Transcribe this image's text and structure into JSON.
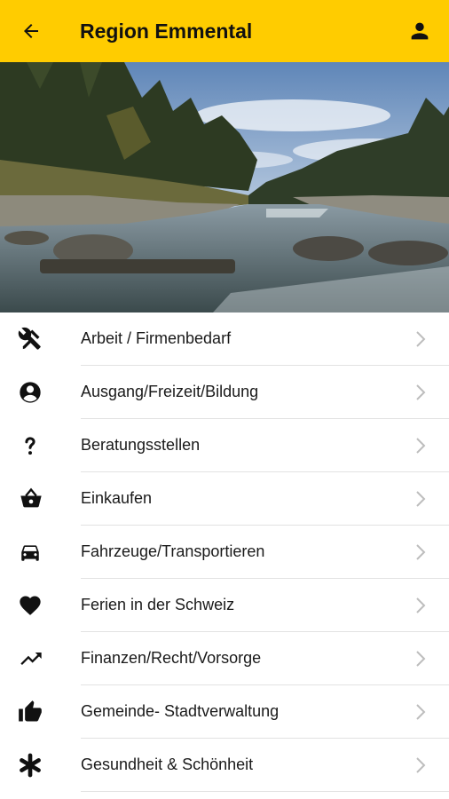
{
  "app": {
    "title": "Region Emmental",
    "accent_color": "#ffcc00"
  },
  "header": {
    "back_icon": "arrow-left-icon",
    "profile_icon": "person-icon"
  },
  "hero": {
    "image": "river-landscape-photo"
  },
  "categories": [
    {
      "label": "Arbeit / Firmenbedarf",
      "icon": "tools-icon"
    },
    {
      "label": "Ausgang/Freizeit/Bildung",
      "icon": "account-circle-icon"
    },
    {
      "label": "Beratungsstellen",
      "icon": "question-mark-icon"
    },
    {
      "label": "Einkaufen",
      "icon": "shopping-basket-icon"
    },
    {
      "label": "Fahrzeuge/Transportieren",
      "icon": "car-icon"
    },
    {
      "label": "Ferien in der Schweiz",
      "icon": "heart-icon"
    },
    {
      "label": "Finanzen/Recht/Vorsorge",
      "icon": "trending-up-icon"
    },
    {
      "label": "Gemeinde- Stadtverwaltung",
      "icon": "thumbs-up-icon"
    },
    {
      "label": "Gesundheit & Schönheit",
      "icon": "asterisk-icon"
    }
  ]
}
